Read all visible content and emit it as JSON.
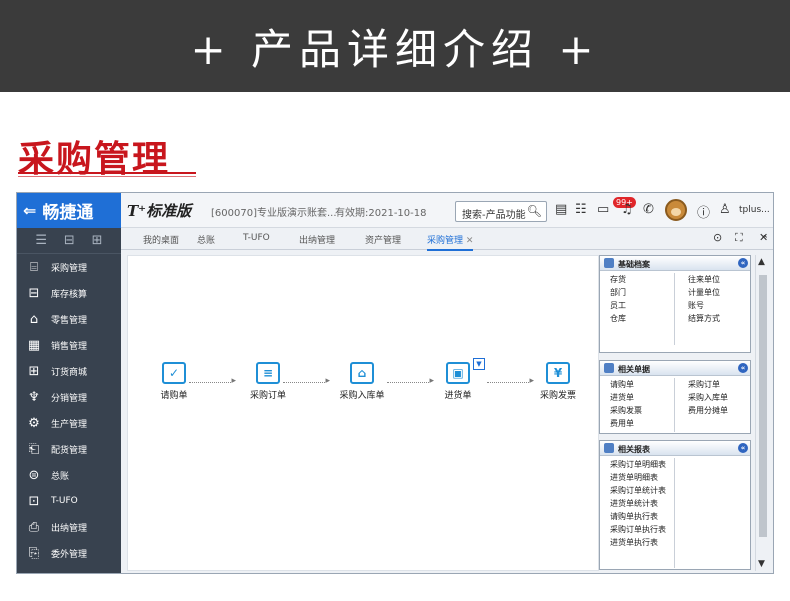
{
  "banner": {
    "title": "+ 产品详细介绍 +"
  },
  "section": {
    "title": "采购管理"
  },
  "app": {
    "brand": "畅捷通",
    "product": "T⁺标准版",
    "account": "[600070]专业版演示账套...",
    "expire": "有效期:2021-10-18",
    "search_placeholder": "搜索-产品功能",
    "badge": "99+",
    "user": "tplus..."
  },
  "sidebar": {
    "items": [
      {
        "label": "采购管理",
        "icon": "purchase-icon"
      },
      {
        "label": "库存核算",
        "icon": "inventory-icon"
      },
      {
        "label": "零售管理",
        "icon": "retail-icon"
      },
      {
        "label": "销售管理",
        "icon": "sales-icon"
      },
      {
        "label": "订货商城",
        "icon": "mall-icon"
      },
      {
        "label": "分销管理",
        "icon": "distribution-icon"
      },
      {
        "label": "生产管理",
        "icon": "production-icon"
      },
      {
        "label": "配货管理",
        "icon": "delivery-icon"
      },
      {
        "label": "总账",
        "icon": "ledger-icon"
      },
      {
        "label": "T-UFO",
        "icon": "ufo-icon"
      },
      {
        "label": "出纳管理",
        "icon": "cashier-icon"
      },
      {
        "label": "委外管理",
        "icon": "outsource-icon"
      }
    ]
  },
  "tabs": [
    {
      "label": "我的桌面"
    },
    {
      "label": "总账"
    },
    {
      "label": "T-UFO"
    },
    {
      "label": "出纳管理"
    },
    {
      "label": "资产管理"
    },
    {
      "label": "采购管理"
    }
  ],
  "flow": {
    "nodes": [
      {
        "label": "请购单",
        "glyph": "✓"
      },
      {
        "label": "采购订单",
        "glyph": "≡"
      },
      {
        "label": "采购入库单",
        "glyph": "⌂"
      },
      {
        "label": "进货单",
        "glyph": "▣"
      },
      {
        "label": "采购发票",
        "glyph": "¥"
      }
    ]
  },
  "panels": {
    "basic": {
      "title": "基础档案",
      "left": [
        "存货",
        "部门",
        "员工",
        "仓库"
      ],
      "right": [
        "往来单位",
        "计量单位",
        "账号",
        "结算方式"
      ]
    },
    "docs": {
      "title": "相关单据",
      "left": [
        "请购单",
        "进货单",
        "采购发票",
        "费用单"
      ],
      "right": [
        "采购订单",
        "采购入库单",
        "费用分摊单"
      ]
    },
    "reports": {
      "title": "相关报表",
      "left": [
        "采购订单明细表",
        "进货单明细表",
        "采购订单统计表",
        "进货单统计表",
        "请购单执行表",
        "采购订单执行表",
        "进货单执行表"
      ]
    }
  }
}
